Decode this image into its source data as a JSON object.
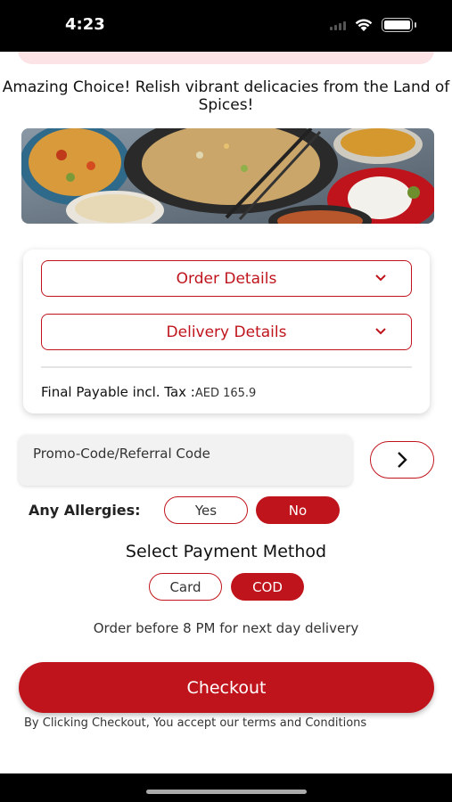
{
  "status_bar": {
    "time": "4:23"
  },
  "headline": "Amazing Choice! Relish vibrant delicacies from the Land of Spices!",
  "details": {
    "order_details_label": "Order Details",
    "delivery_details_label": "Delivery Details",
    "payable_label": "Final Payable incl. Tax :",
    "payable_amount": "AED 165.9"
  },
  "promo": {
    "placeholder": "Promo-Code/Referral Code"
  },
  "allergies": {
    "label": "Any Allergies:",
    "yes_label": "Yes",
    "no_label": "No",
    "selected": "No"
  },
  "payment": {
    "title": "Select Payment Method",
    "card_label": "Card",
    "cod_label": "COD",
    "selected": "COD"
  },
  "delivery_note": "Order before 8 PM for next day delivery",
  "checkout": {
    "button_label": "Checkout",
    "terms": "By Clicking Checkout, You accept our terms and Conditions"
  },
  "colors": {
    "accent": "#c0141c",
    "pink_strip": "#fbe3e6"
  },
  "icons": [
    "wifi-icon",
    "battery-icon",
    "chevron-down-icon",
    "chevron-right-icon"
  ]
}
